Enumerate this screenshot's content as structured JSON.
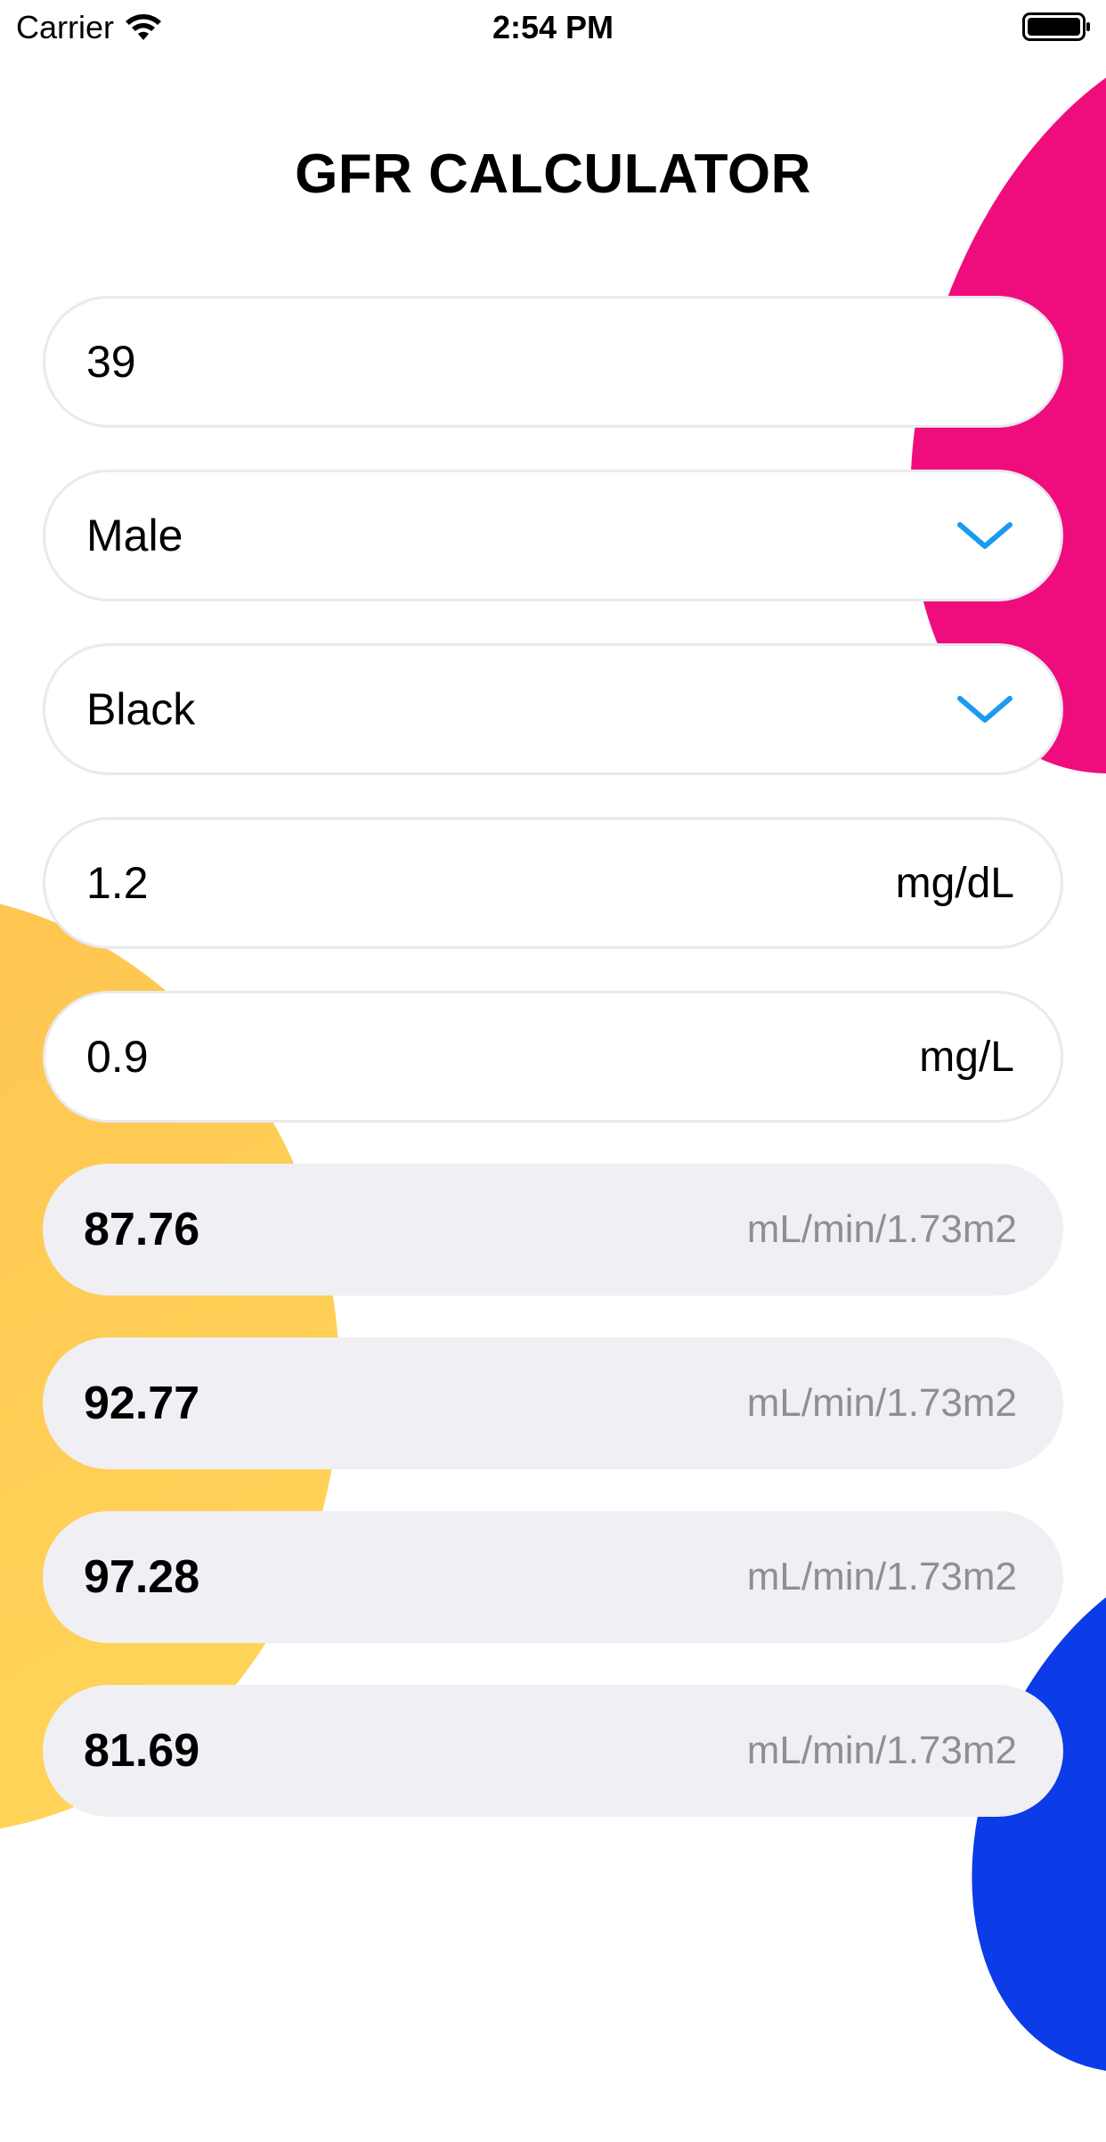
{
  "status_bar": {
    "carrier": "Carrier",
    "time": "2:54 PM"
  },
  "title": "GFR CALCULATOR",
  "form": {
    "age": "39",
    "sex": "Male",
    "race": "Black",
    "creatinine_value": "1.2",
    "creatinine_unit": "mg/dL",
    "cystatin_value": "0.9",
    "cystatin_unit": "mg/L"
  },
  "results": [
    {
      "value": "87.76",
      "unit": "mL/min/1.73m2"
    },
    {
      "value": "92.77",
      "unit": "mL/min/1.73m2"
    },
    {
      "value": "97.28",
      "unit": "mL/min/1.73m2"
    },
    {
      "value": "81.69",
      "unit": "mL/min/1.73m2"
    }
  ],
  "colors": {
    "accent": "#1a9bf0",
    "pink": "#ef0d7e",
    "yellow": "#ffc24f",
    "blue": "#0c3be8",
    "result_bg": "#efeff4"
  },
  "icons": {
    "signal": "wifi-icon",
    "battery": "battery-icon",
    "dropdown": "chevron-down-icon"
  }
}
